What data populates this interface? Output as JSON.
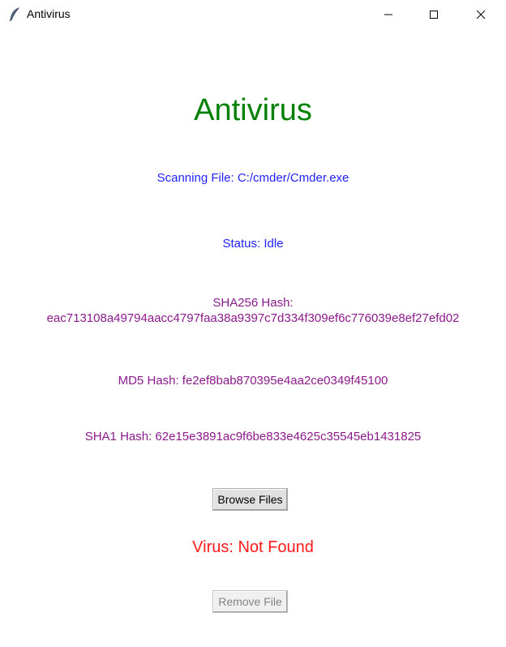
{
  "window": {
    "title": "Antivirus",
    "icon": "feather-icon"
  },
  "main": {
    "heading": "Antivirus",
    "scanning_file": "Scanning File: C:/cmder/Cmder.exe",
    "status": "Status: Idle",
    "sha256_label": "SHA256 Hash:",
    "sha256_value": "eac713108a49794aacc4797faa38a9397c7d334f309ef6c776039e8ef27efd02",
    "md5": "MD5 Hash: fe2ef8bab870395e4aa2ce0349f45100",
    "sha1": "SHA1 Hash: 62e15e3891ac9f6be833e4625c35545eb1431825",
    "browse_button": "Browse Files",
    "virus_result": "Virus: Not Found",
    "remove_button": "Remove File"
  },
  "colors": {
    "heading": "#008000",
    "info_blue": "#1f1fff",
    "hash_purple": "#8b1a8b",
    "virus_red": "#ff1a1a"
  }
}
